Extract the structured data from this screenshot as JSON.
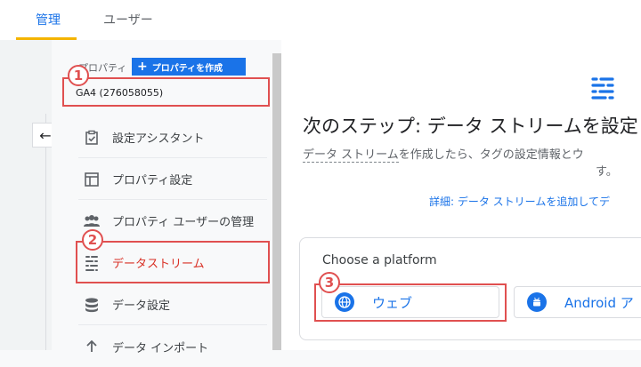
{
  "tabs": {
    "admin": "管理",
    "users": "ユーザー"
  },
  "back_icon": "←",
  "property": {
    "label": "プロパティ",
    "create_button": "プロパティを作成",
    "create_button_icon": "+",
    "value": "GA4 (276058055)"
  },
  "menu": [
    {
      "label": "設定アシスタント",
      "icon": "clipboard-check-icon"
    },
    {
      "label": "プロパティ設定",
      "icon": "window-layout-icon"
    },
    {
      "label": "プロパティ ユーザーの管理",
      "icon": "people-icon"
    },
    {
      "label": "データストリーム",
      "icon": "data-stream-icon"
    },
    {
      "label": "データ設定",
      "icon": "database-icon"
    },
    {
      "label": "データ インポート",
      "icon": "upload-icon"
    }
  ],
  "annotations": {
    "one": "1",
    "two": "2",
    "three": "3"
  },
  "main": {
    "title": "次のステップ: データ ストリームを設定",
    "desc_dotted": "データ ストリーム",
    "desc_rest": "を作成したら、タグの設定情報とウ",
    "desc_line2": "す。",
    "learn_more": "詳細: データ ストリームを追加してデ",
    "choose_platform": "Choose a platform",
    "web_label": "ウェブ",
    "android_label": "Android ア"
  },
  "colors": {
    "accent": "#1a73e8",
    "annotation_red": "#e05050",
    "active_red": "#d93025",
    "tab_underline": "#f4b400"
  }
}
